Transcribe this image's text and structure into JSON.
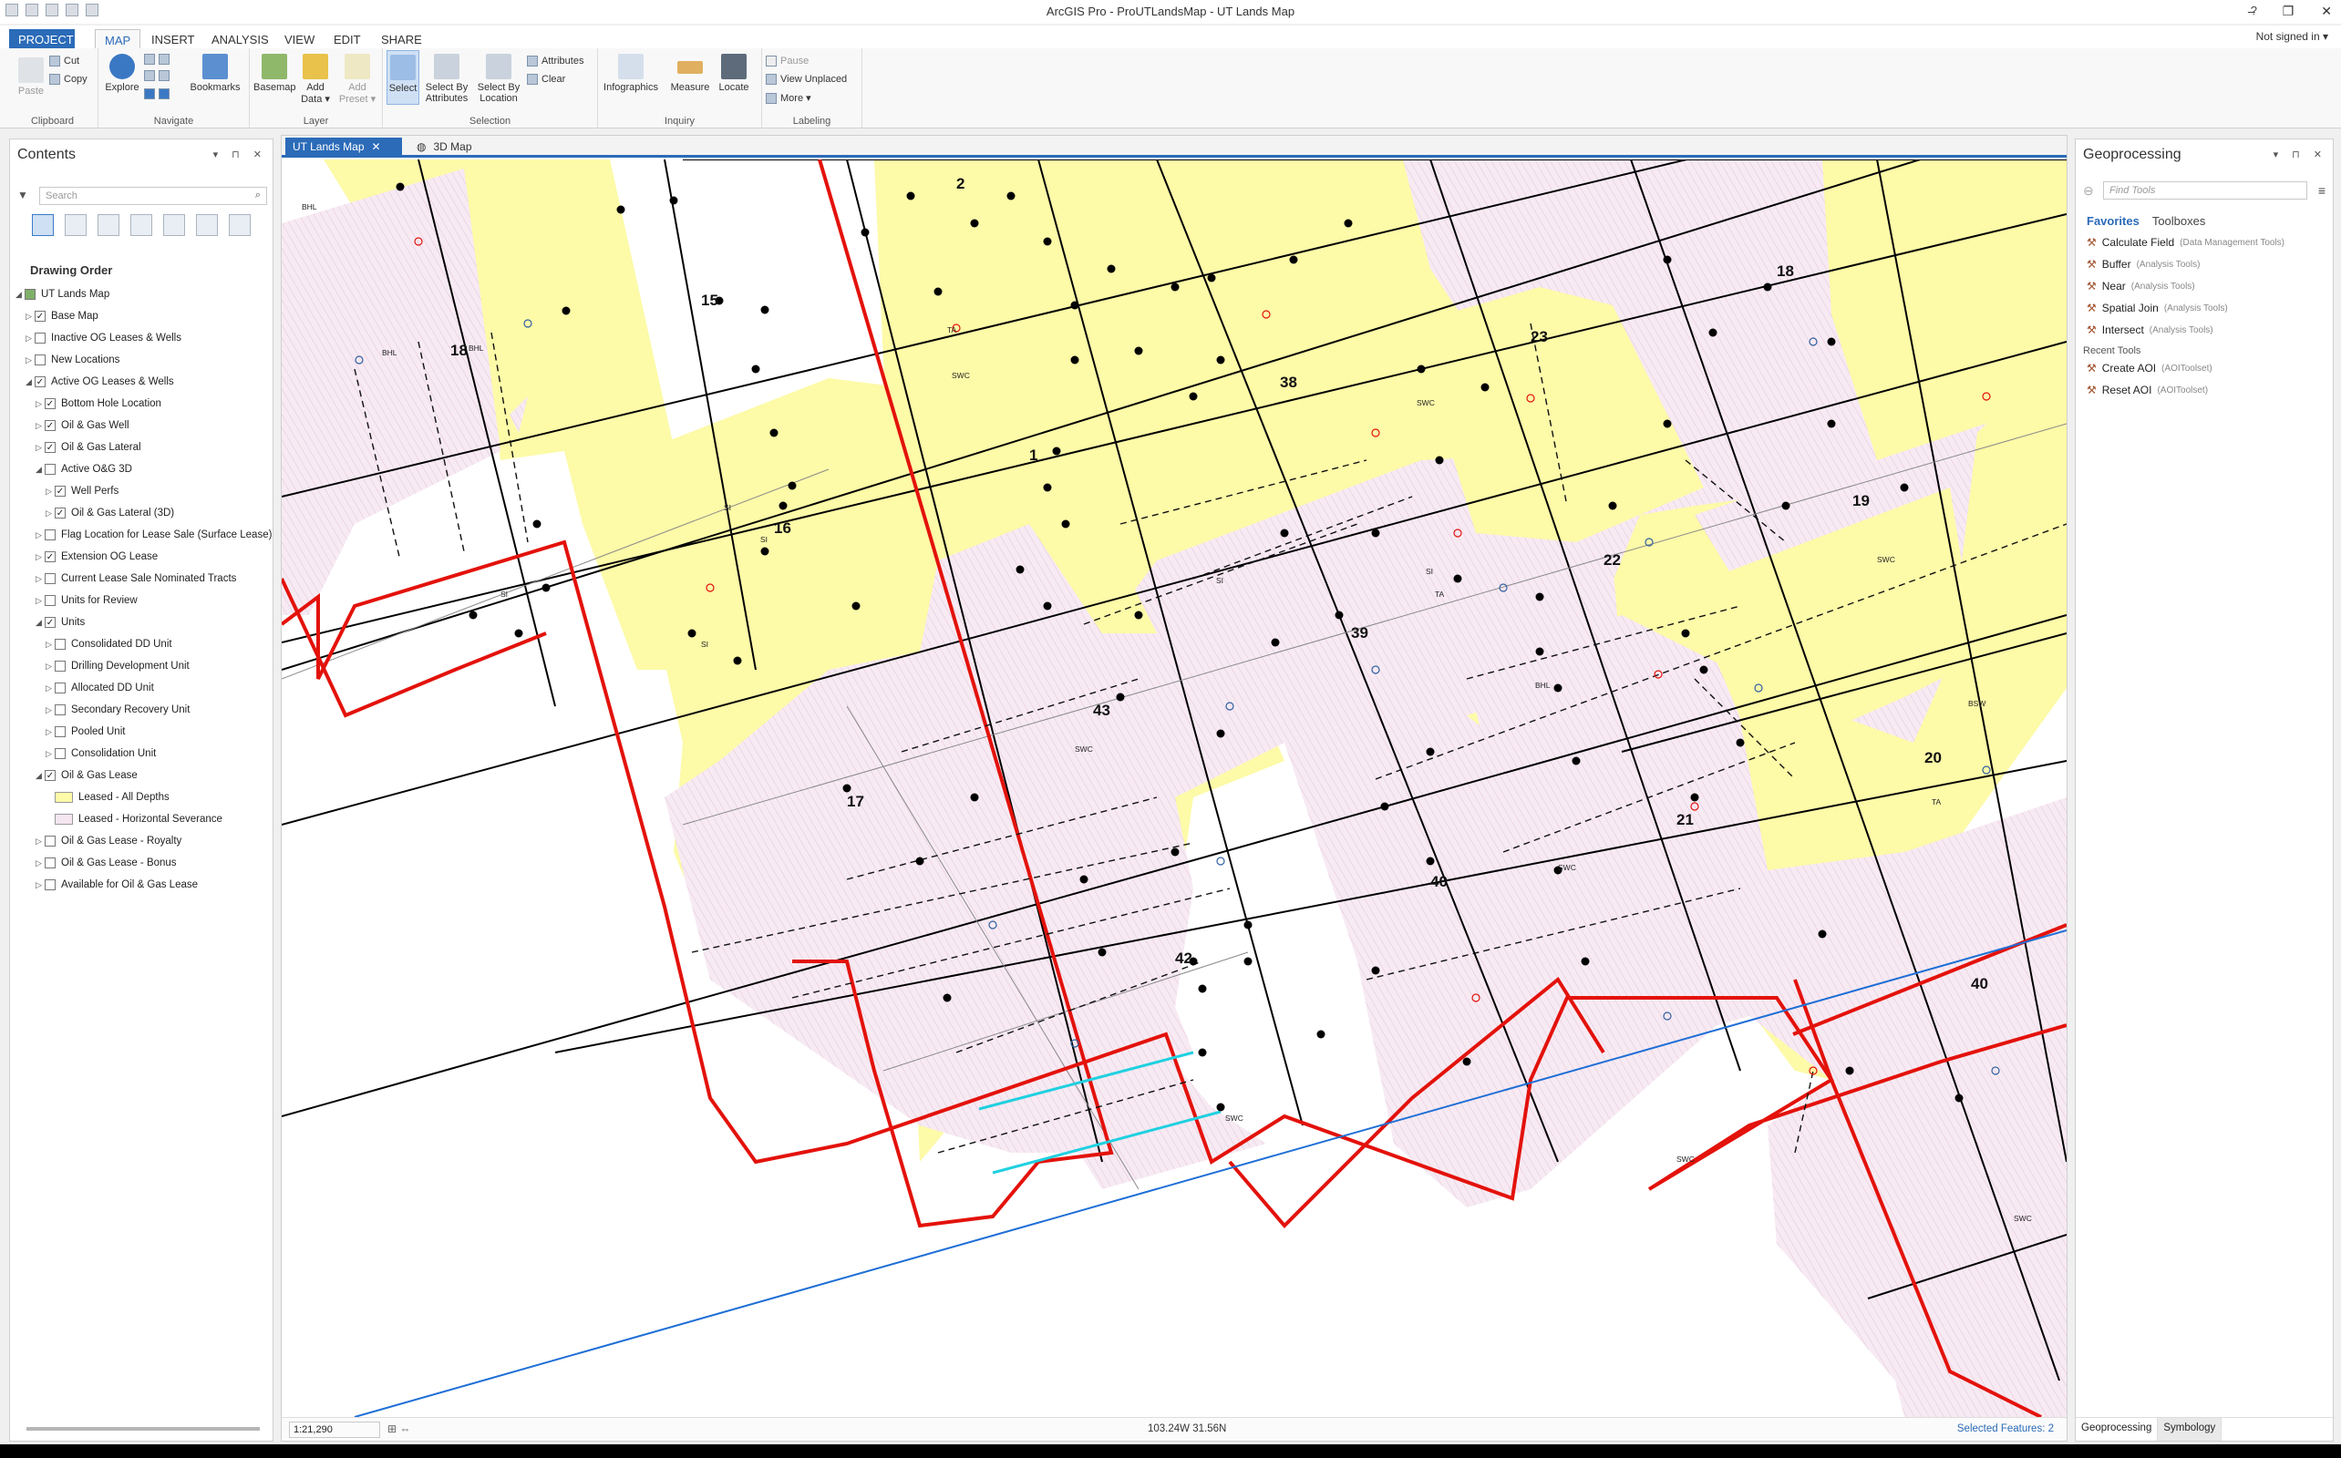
{
  "window": {
    "title": "ArcGIS Pro - ProUTLandsMap - UT Lands Map",
    "help": "?",
    "minimize": "–",
    "restore": "❐",
    "close": "✕"
  },
  "ribbon_tabs": [
    "PROJECT",
    "MAP",
    "INSERT",
    "ANALYSIS",
    "VIEW",
    "EDIT",
    "SHARE"
  ],
  "user": "Not signed in ▾",
  "ribbon": {
    "clipboard": {
      "label": "Clipboard",
      "paste": "Paste",
      "cut": "Cut",
      "copy": "Copy"
    },
    "navigate": {
      "label": "Navigate",
      "explore": "Explore",
      "bookmarks": "Bookmarks"
    },
    "layer": {
      "label": "Layer",
      "basemap": "Basemap",
      "add_data": "Add Data ▾",
      "add_preset": "Add Preset ▾"
    },
    "selection": {
      "label": "Selection",
      "select": "Select",
      "select_by_attributes": "Select By Attributes",
      "select_by_location": "Select By Location",
      "attributes": "Attributes",
      "clear": "Clear"
    },
    "inquiry": {
      "label": "Inquiry",
      "infographics": "Infographics",
      "measure": "Measure",
      "locate": "Locate"
    },
    "labeling": {
      "label": "Labeling",
      "pause": "Pause",
      "view_unplaced": "View Unplaced",
      "more": "More ▾"
    }
  },
  "contents": {
    "title": "Contents",
    "search_placeholder": "Search",
    "drawing_order": "Drawing Order",
    "layers": [
      {
        "label": "UT Lands Map",
        "level": 0,
        "twisty": "◢",
        "checkbox": "map"
      },
      {
        "label": "Base Map",
        "level": 1,
        "twisty": "▷",
        "checked": "✓"
      },
      {
        "label": "Inactive OG Leases & Wells",
        "level": 1,
        "twisty": "▷",
        "checked": ""
      },
      {
        "label": "New Locations",
        "level": 1,
        "twisty": "▷",
        "checked": ""
      },
      {
        "label": "Active OG Leases & Wells",
        "level": 1,
        "twisty": "◢",
        "checked": "✓"
      },
      {
        "label": "Bottom Hole Location",
        "level": 2,
        "twisty": "▷",
        "checked": "✓"
      },
      {
        "label": "Oil & Gas Well",
        "level": 2,
        "twisty": "▷",
        "checked": "✓"
      },
      {
        "label": "Oil & Gas Lateral",
        "level": 2,
        "twisty": "▷",
        "checked": "✓"
      },
      {
        "label": "Active O&G 3D",
        "level": 2,
        "twisty": "◢",
        "checked": ""
      },
      {
        "label": "Well Perfs",
        "level": 3,
        "twisty": "▷",
        "checked": "✓"
      },
      {
        "label": "Oil & Gas Lateral (3D)",
        "level": 3,
        "twisty": "▷",
        "checked": "✓"
      },
      {
        "label": "Flag Location for Lease Sale (Surface Lease)",
        "level": 2,
        "twisty": "▷",
        "checked": ""
      },
      {
        "label": "Extension OG Lease",
        "level": 2,
        "twisty": "▷",
        "checked": "✓"
      },
      {
        "label": "Current Lease Sale Nominated Tracts",
        "level": 2,
        "twisty": "▷",
        "checked": ""
      },
      {
        "label": "Units for Review",
        "level": 2,
        "twisty": "▷",
        "checked": ""
      },
      {
        "label": "Units",
        "level": 2,
        "twisty": "◢",
        "checked": "✓"
      },
      {
        "label": "Consolidated DD Unit",
        "level": 3,
        "twisty": "▷",
        "checked": ""
      },
      {
        "label": "Drilling Development Unit",
        "level": 3,
        "twisty": "▷",
        "checked": ""
      },
      {
        "label": "Allocated DD Unit",
        "level": 3,
        "twisty": "▷",
        "checked": ""
      },
      {
        "label": "Secondary Recovery Unit",
        "level": 3,
        "twisty": "▷",
        "checked": ""
      },
      {
        "label": "Pooled Unit",
        "level": 3,
        "twisty": "▷",
        "checked": ""
      },
      {
        "label": "Consolidation Unit",
        "level": 3,
        "twisty": "▷",
        "checked": ""
      },
      {
        "label": "Oil & Gas Lease",
        "level": 2,
        "twisty": "◢",
        "checked": "✓"
      },
      {
        "label": "Leased - All Depths",
        "level": 3,
        "swatch": "#fdfaa8"
      },
      {
        "label": "Leased - Horizontal Severance",
        "level": 3,
        "swatch": "#f5e6f0"
      },
      {
        "label": "Oil & Gas Lease - Royalty",
        "level": 2,
        "twisty": "▷",
        "checked": ""
      },
      {
        "label": "Oil & Gas Lease - Bonus",
        "level": 2,
        "twisty": "▷",
        "checked": ""
      },
      {
        "label": "Available for Oil & Gas Lease",
        "level": 2,
        "twisty": "▷",
        "checked": ""
      }
    ]
  },
  "map_tabs": {
    "active": "UT Lands Map",
    "other": "3D Map",
    "close": "✕"
  },
  "map": {
    "colors": {
      "leased_all": "#fdfaa8",
      "severance": "#f7eaf3",
      "hatch": "#e3c4d8",
      "boundary": "#e3120b",
      "line": "#000000",
      "selected": "#20d0e0",
      "road": "#1f6fd6"
    },
    "section_labels": [
      "2",
      "15",
      "18",
      "16",
      "1",
      "38",
      "17",
      "43",
      "39",
      "42",
      "40",
      "23",
      "22",
      "18",
      "19",
      "20",
      "21",
      "40"
    ],
    "well_labels": [
      "BHL",
      "SI",
      "SWC",
      "TA",
      "BSW"
    ]
  },
  "status": {
    "scale": "1:21,290",
    "coords": "103.24W 31.56N",
    "selected": "Selected Features: 2"
  },
  "geoprocessing": {
    "title": "Geoprocessing",
    "search_placeholder": "Find Tools",
    "tab_favorites": "Favorites",
    "tab_toolboxes": "Toolboxes",
    "favorites": [
      {
        "name": "Calculate Field",
        "toolbox": "(Data Management Tools)"
      },
      {
        "name": "Buffer",
        "toolbox": "(Analysis Tools)"
      },
      {
        "name": "Near",
        "toolbox": "(Analysis Tools)"
      },
      {
        "name": "Spatial Join",
        "toolbox": "(Analysis Tools)"
      },
      {
        "name": "Intersect",
        "toolbox": "(Analysis Tools)"
      }
    ],
    "recent_label": "Recent Tools",
    "recent": [
      {
        "name": "Create AOI",
        "toolbox": "(AOIToolset)"
      },
      {
        "name": "Reset AOI",
        "toolbox": "(AOIToolset)"
      }
    ],
    "bottom_tabs": [
      "Geoprocessing",
      "Symbology"
    ]
  }
}
